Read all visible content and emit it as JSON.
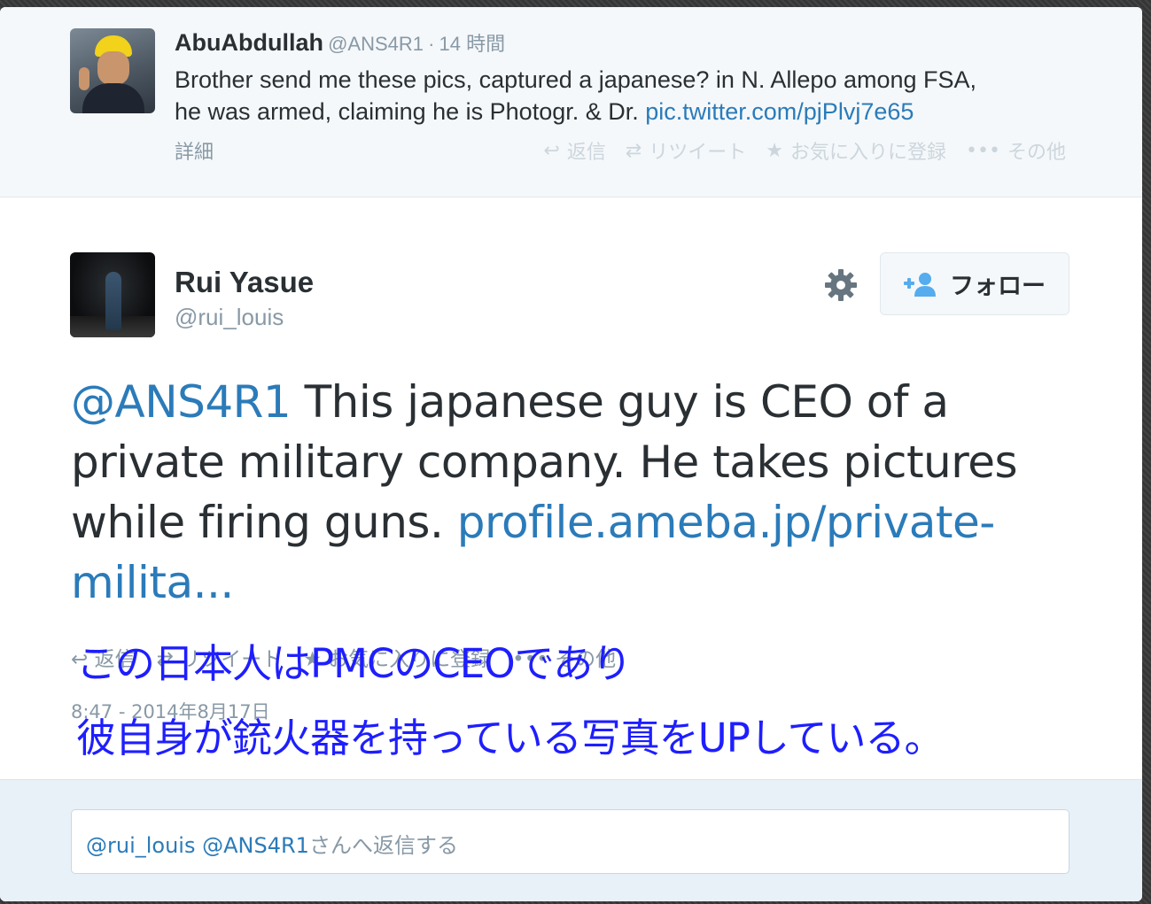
{
  "parent_tweet": {
    "name": "AbuAbdullah",
    "handle": "@ANS4R1",
    "separator": "·",
    "time": "14 時間",
    "text_lines": [
      "Brother send me these pics, captured a japanese? in N. Allepo among FSA,",
      "he was armed, claiming he is Photogr. & Dr. "
    ],
    "link": "pic.twitter.com/pjPlvj7e65",
    "detail": "詳細",
    "actions": [
      {
        "icon": "reply-icon",
        "label": "返信"
      },
      {
        "icon": "retweet-icon",
        "label": "リツイート"
      },
      {
        "icon": "star-icon",
        "label": "お気に入りに登録"
      },
      {
        "icon": "more-icon",
        "label": "その他"
      }
    ]
  },
  "main_tweet": {
    "name": "Rui Yasue",
    "handle": "@rui_louis",
    "follow_label": "フォロー",
    "mention": "@ANS4R1",
    "text": " This japanese guy is CEO of a private military company. He takes pictures while firing guns. ",
    "url": "profile.ameba.jp/private-milita...",
    "actions": [
      {
        "icon": "reply-icon",
        "label": "返信"
      },
      {
        "icon": "retweet-icon",
        "label": "リツイート"
      },
      {
        "icon": "star-icon",
        "label": "お気に入りに登録"
      },
      {
        "icon": "more-icon",
        "label": "その他"
      }
    ],
    "date": "8:47 - 2014年8月17日"
  },
  "overlay_text": {
    "line1": "この日本人はPMCのCEOであり",
    "line2": "彼自身が銃火器を持っている写真をUPしている。"
  },
  "reply": {
    "mention1": "@rui_louis",
    "mention2": "@ANS4R1",
    "suffix": "さんへ返信する"
  },
  "colors": {
    "link": "#2b7bb9",
    "overlay": "#1e1eff",
    "muted": "#8899a6"
  }
}
